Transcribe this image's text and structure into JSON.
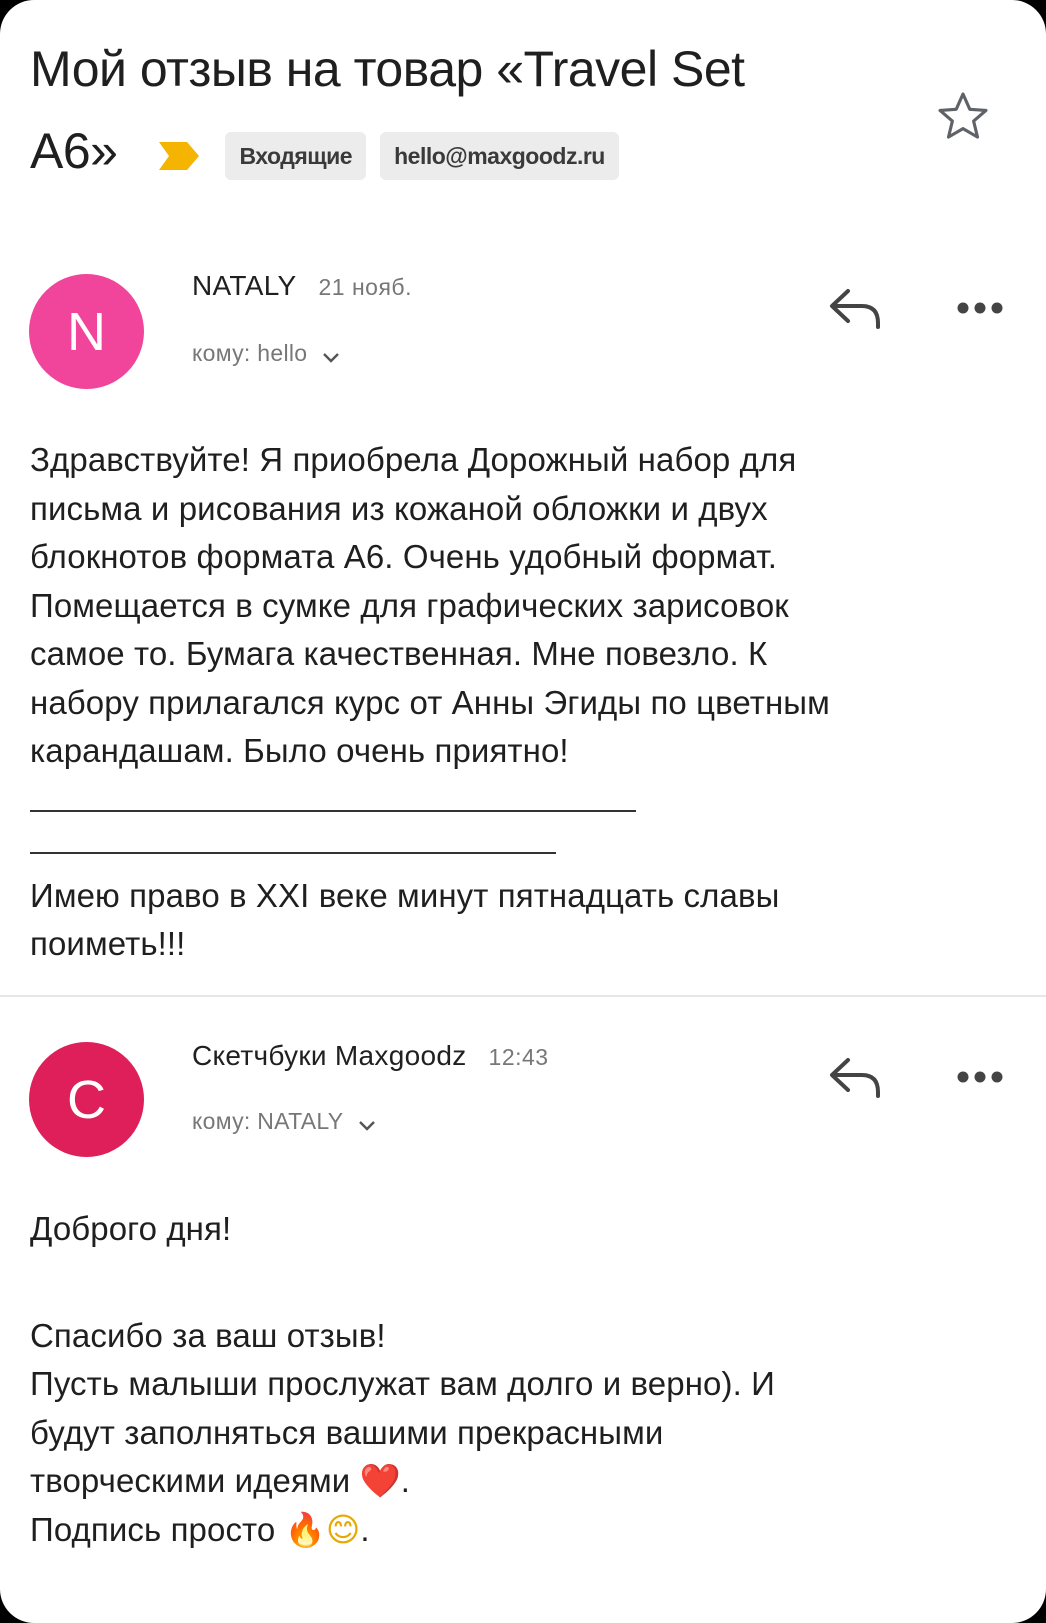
{
  "subject": {
    "line1": "Мой отзыв на товар «Travel Set",
    "line2": "A6»",
    "labels": [
      "Входящие",
      "hello@maxgoodz.ru"
    ]
  },
  "icons": {
    "importance": "importance-marker-icon",
    "star": "star-icon",
    "reply": "reply-icon",
    "more": "more-icon",
    "chevron": "chevron-down-icon"
  },
  "colors": {
    "importance": "#f4b400",
    "avatar_n": "#f1449b",
    "avatar_c": "#de1f5a"
  },
  "messages": [
    {
      "avatar_letter": "N",
      "sender": "NATALY",
      "time": "21 нояб.",
      "recipient": "кому: hello",
      "body": {
        "lines": [
          "Здравствуйте! Я приобрела Дорожный набор для",
          "письма и рисования из кожаной обложки и двух",
          "блокнотов формата А6. Очень удобный формат.",
          "Помещается в сумке для графических зарисовок",
          "самое то. Бумага качественная. Мне повезло. К",
          "набору прилагался курс от Анны Эгиды по цветным",
          "карандашам. Было очень приятно!"
        ],
        "signature": [
          "Имею право в XXI веке минут пятнадцать славы",
          "поиметь!!!"
        ]
      }
    },
    {
      "avatar_letter": "C",
      "sender": "Скетчбуки Maxgoodz",
      "time": "12:43",
      "recipient": "кому: NATALY",
      "body": {
        "greeting": "Доброго дня!",
        "lines": [
          "Спасибо за ваш отзыв!",
          "Пусть малыши прослужат вам долго и верно). И",
          "будут заполняться вашими прекрасными",
          "творческими идеями"
        ],
        "last_line": "Подпись просто",
        "emojis": [
          "❤️",
          "🔥",
          "😊"
        ],
        "dot": "."
      }
    }
  ]
}
